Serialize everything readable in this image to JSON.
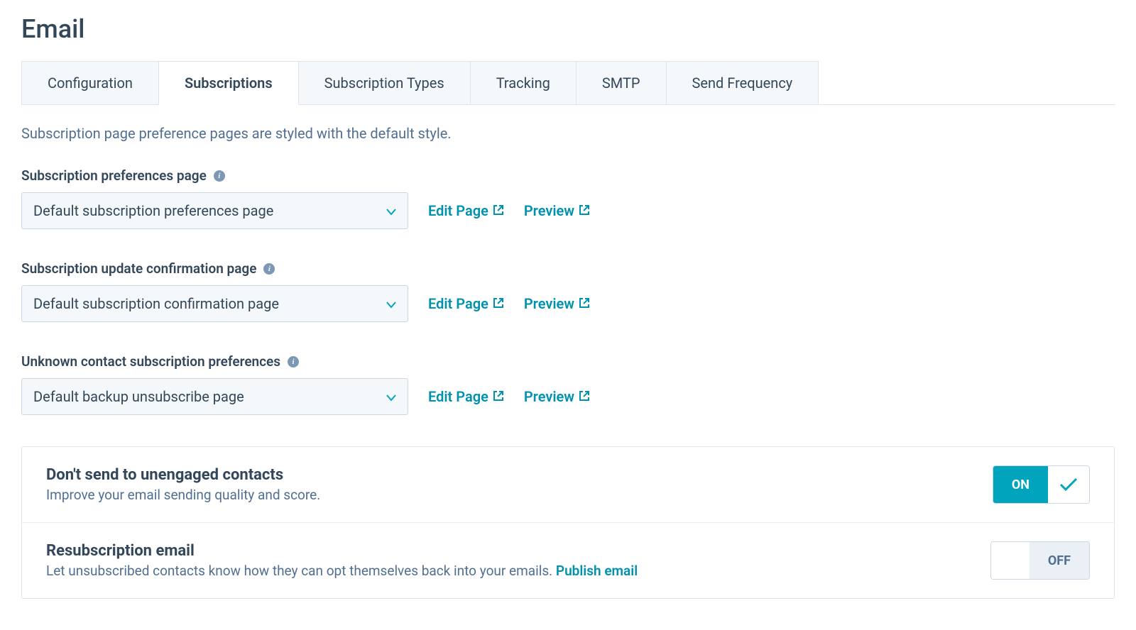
{
  "page": {
    "title": "Email",
    "intro": "Subscription page preference pages are styled with the default style."
  },
  "tabs": [
    {
      "label": "Configuration",
      "active": false
    },
    {
      "label": "Subscriptions",
      "active": true
    },
    {
      "label": "Subscription Types",
      "active": false
    },
    {
      "label": "Tracking",
      "active": false
    },
    {
      "label": "SMTP",
      "active": false
    },
    {
      "label": "Send Frequency",
      "active": false
    }
  ],
  "fields": {
    "prefs": {
      "label": "Subscription preferences page",
      "selected": "Default subscription preferences page",
      "edit": "Edit Page",
      "preview": "Preview"
    },
    "confirm": {
      "label": "Subscription update confirmation page",
      "selected": "Default subscription confirmation page",
      "edit": "Edit Page",
      "preview": "Preview"
    },
    "unknown": {
      "label": "Unknown contact subscription preferences",
      "selected": "Default backup unsubscribe page",
      "edit": "Edit Page",
      "preview": "Preview"
    }
  },
  "cards": {
    "unengaged": {
      "title": "Don't send to unengaged contacts",
      "desc": "Improve your email sending quality and score.",
      "toggle": "ON"
    },
    "resub": {
      "title": "Resubscription email",
      "desc": "Let unsubscribed contacts know how they can opt themselves back into your emails.  ",
      "link": "Publish email",
      "toggle": "OFF"
    }
  }
}
